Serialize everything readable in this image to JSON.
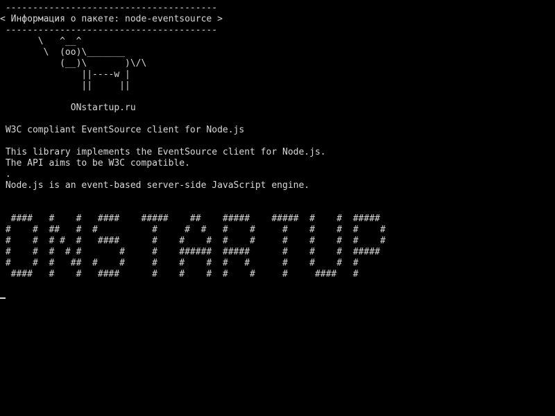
{
  "terminal": {
    "banner_top": " ---------------------------------------",
    "banner_title": "< Информация о пакете: node-eventsource >",
    "banner_bottom": " ---------------------------------------",
    "cow": [
      "       \\   ^__^",
      "        \\  (oo)\\_______",
      "           (__)\\       )\\/\\",
      "               ||----w |",
      "               ||     ||"
    ],
    "site": "             ONstartup.ru",
    "description_title": " W3C compliant EventSource client for Node.js",
    "description_body": [
      " This library implements the EventSource client for Node.js.",
      " The API aims to be W3C compatible.",
      " .",
      " Node.js is an event-based server-side JavaScript engine."
    ],
    "banner_art": [
      "  ####   #    #   ####    #####    ##    #####    #####  #    #  #####",
      " #    #  ##   #  #          #     #  #   #    #     #    #    #  #    #",
      " #    #  # #  #   ####      #    #    #  #    #     #    #    #  #    #",
      " #    #  #  # #       #     #    ######  #####      #    #    #  #####",
      " #    #  #   ##  #    #     #    #    #  #   #      #    #    #  #",
      "  ####   #    #   ####      #    #    #  #    #     #     ####   #"
    ],
    "colors": {
      "background": "#000000",
      "foreground": "#d8d8d8"
    }
  }
}
